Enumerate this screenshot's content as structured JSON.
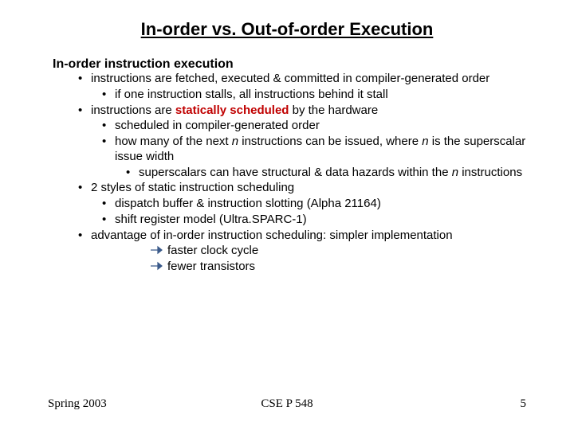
{
  "title": "In-order vs. Out-of-order Execution",
  "heading": "In-order instruction execution",
  "b1": "instructions are fetched, executed & committed in compiler-generated order",
  "b1a": "if one instruction stalls, all instructions behind it stall",
  "b2_pre": "instructions are ",
  "b2_em": "statically scheduled",
  "b2_post": " by the hardware",
  "b2a": "scheduled in compiler-generated order",
  "b2b_pre": "how many of the next ",
  "b2b_n1": "n",
  "b2b_mid": " instructions can be issued, where ",
  "b2b_n2": "n",
  "b2b_post": " is the superscalar issue width",
  "b2b_i_pre": "superscalars can have structural & data hazards within the ",
  "b2b_i_n": "n",
  "b2b_i_post": " instructions",
  "b3": "2 styles of static instruction scheduling",
  "b3a": "dispatch buffer & instruction slotting (Alpha 21164)",
  "b3b": "shift register model (Ultra.SPARC-1)",
  "b4": "advantage of in-order instruction scheduling: simpler implementation",
  "b4a": "faster clock cycle",
  "b4b": "fewer transistors",
  "footer_left": "Spring 2003",
  "footer_center": "CSE P 548",
  "footer_right": "5"
}
